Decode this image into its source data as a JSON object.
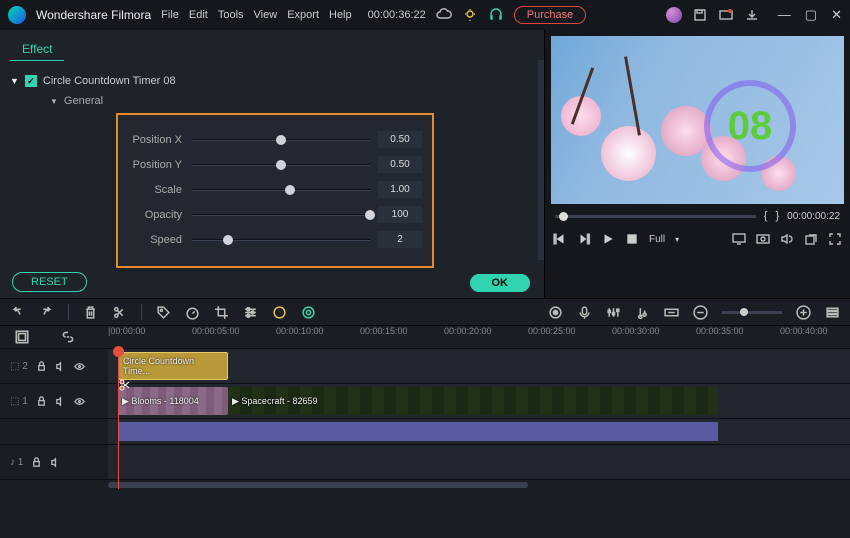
{
  "app": {
    "name": "Wondershare Filmora"
  },
  "menu": [
    "File",
    "Edit",
    "Tools",
    "View",
    "Export",
    "Help"
  ],
  "project_time": "00:00:36:22",
  "purchase_label": "Purchase",
  "effect": {
    "tab": "Effect",
    "title": "Circle Countdown Timer 08",
    "section": "General",
    "params": [
      {
        "label": "Position X",
        "value": "0.50",
        "pos": 50
      },
      {
        "label": "Position Y",
        "value": "0.50",
        "pos": 50
      },
      {
        "label": "Scale",
        "value": "1.00",
        "pos": 55
      },
      {
        "label": "Opacity",
        "value": "100",
        "pos": 100
      },
      {
        "label": "Speed",
        "value": "2",
        "pos": 20
      }
    ],
    "reset": "RESET",
    "ok": "OK"
  },
  "preview": {
    "count": "08",
    "time": "00:00:00:22",
    "quality": "Full"
  },
  "ruler": [
    "|00:00:00",
    "00:00:05:00",
    "00:00:10:00",
    "00:00:15:00",
    "00:00:20:00",
    "00:00:25:00",
    "00:00:30:00",
    "00:00:35:00",
    "00:00:40:00"
  ],
  "tracks": {
    "t2": {
      "name": "⬚ 2",
      "clip": "Circle Countdown Time..."
    },
    "t1": {
      "name": "⬚ 1",
      "clipA": "Blooms - 118004",
      "clipB": "Spacecraft - 82659"
    },
    "a1": {
      "name": "♪ 1"
    }
  }
}
